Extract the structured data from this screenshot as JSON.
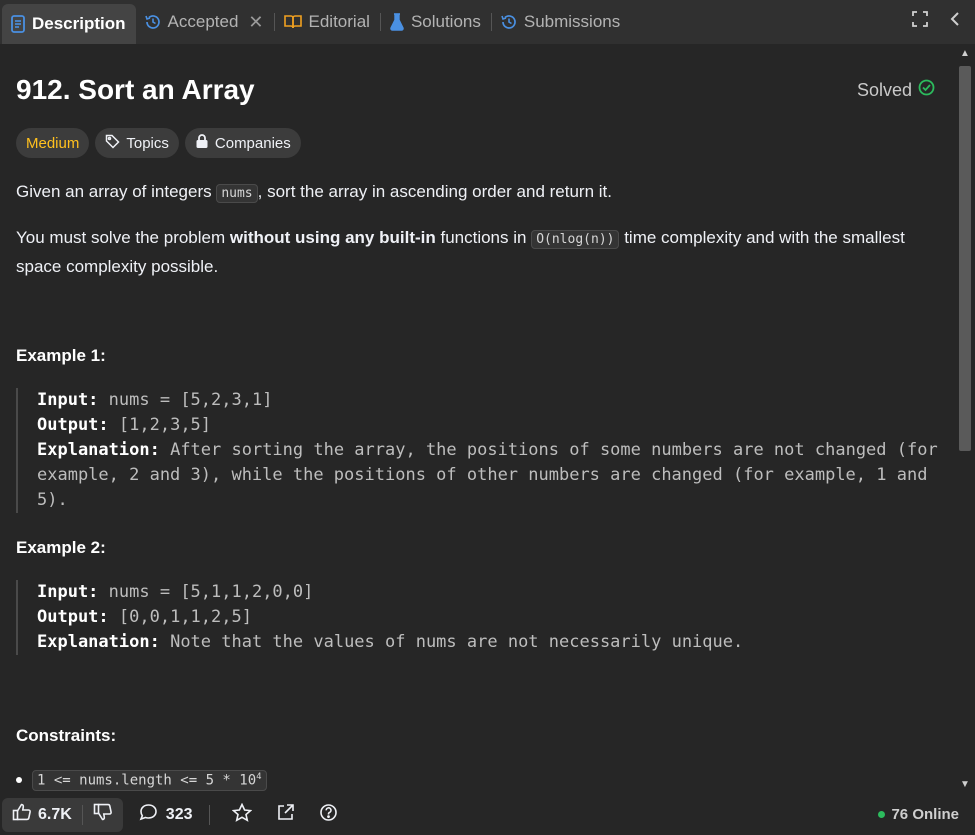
{
  "tabs": [
    {
      "label": "Description",
      "icon": "document-icon"
    },
    {
      "label": "Accepted",
      "icon": "history-icon"
    },
    {
      "label": "Editorial",
      "icon": "book-icon"
    },
    {
      "label": "Solutions",
      "icon": "flask-icon"
    },
    {
      "label": "Submissions",
      "icon": "history-icon"
    }
  ],
  "problem": {
    "title": "912. Sort an Array",
    "status": "Solved",
    "difficulty": "Medium",
    "topics_label": "Topics",
    "companies_label": "Companies",
    "p1_before": "Given an array of integers ",
    "p1_code": "nums",
    "p1_after": ", sort the array in ascending order and return it.",
    "p2_before": "You must solve the problem ",
    "p2_bold": "without using any built-in",
    "p2_mid": " functions in ",
    "p2_code": "O(nlog(n))",
    "p2_after": " time complexity and with the smallest space complexity possible."
  },
  "examples": [
    {
      "heading": "Example 1:",
      "input_label": "Input:",
      "input": "nums = [5,2,3,1]",
      "output_label": "Output:",
      "output": "[1,2,3,5]",
      "explanation_label": "Explanation:",
      "explanation": "After sorting the array, the positions of some numbers are not changed (for example, 2 and 3), while the positions of other numbers are changed (for example, 1 and 5)."
    },
    {
      "heading": "Example 2:",
      "input_label": "Input:",
      "input": "nums = [5,1,1,2,0,0]",
      "output_label": "Output:",
      "output": "[0,0,1,1,2,5]",
      "explanation_label": "Explanation:",
      "explanation": "Note that the values of nums are not necessarily unique."
    }
  ],
  "constraints": {
    "heading": "Constraints:",
    "item1_main": "1 <= nums.length <= 5 * 10",
    "item1_sup": "4"
  },
  "footer": {
    "likes": "6.7K",
    "comments": "323",
    "online": "76 Online"
  },
  "colors": {
    "difficulty": "#ffc01e",
    "solved": "#2cbb5d"
  }
}
